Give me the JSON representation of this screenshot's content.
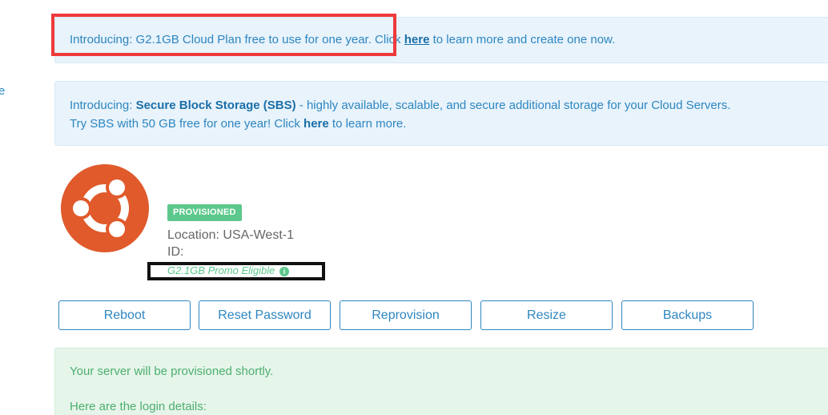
{
  "edge_glyph": "e",
  "banners": [
    {
      "prefix": "Introducing: G2.1GB Cloud Plan free to use for one year. Click ",
      "link": "here",
      "suffix": " to learn more and create one now."
    },
    {
      "line1_prefix": "Introducing: ",
      "line1_bold": "Secure Block Storage (SBS)",
      "line1_suffix": " - highly available, scalable, and secure additional storage for your Cloud Servers.",
      "line2_prefix": "Try SBS with 50 GB free for one year! Click ",
      "line2_link": "here",
      "line2_suffix": " to learn more."
    }
  ],
  "server": {
    "os_icon": "ubuntu-logo-icon",
    "status": "PROVISIONED",
    "location": "Location: USA-West-1",
    "id_label": "ID:",
    "promo": "G2.1GB Promo Eligible",
    "promo_icon": "info-icon"
  },
  "actions": [
    "Reboot",
    "Reset Password",
    "Reprovision",
    "Resize",
    "Backups"
  ],
  "success": {
    "line1": "Your server will be provisioned shortly.",
    "line2": "Here are the login details:"
  },
  "colors": {
    "accent": "#2e86c1",
    "banner_bg": "#e8f3fb",
    "success": "#5cc88b",
    "ubuntu": "#e05a2b",
    "highlight_red": "#ee3a3a"
  }
}
